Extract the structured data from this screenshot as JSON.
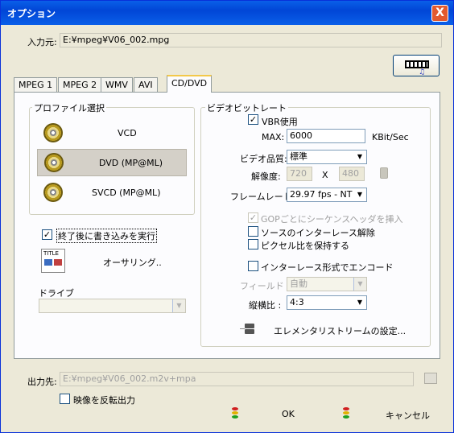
{
  "window": {
    "title": "オプション",
    "close": "X"
  },
  "input": {
    "label": "入力元:",
    "value": "E:¥mpeg¥V06_002.mpg"
  },
  "tabs": [
    "MPEG 1",
    "MPEG 2",
    "WMV",
    "AVI",
    "CD/DVD"
  ],
  "profile": {
    "group_label": "プロファイル選択",
    "items": [
      "VCD",
      "DVD (MP@ML)",
      "SVCD (MP@ML)"
    ]
  },
  "burn": {
    "label": "終了後に書き込みを実行",
    "checked": true
  },
  "authoring": {
    "label": "オーサリング..",
    "icon_text": "TITLE"
  },
  "drive": {
    "label": "ドライブ",
    "value": ""
  },
  "bitrate": {
    "group_label": "ビデオビットレート",
    "vbr_label": "VBR使用",
    "max_label": "MAX:",
    "max_value": "6000",
    "unit": "KBit/Sec"
  },
  "quality": {
    "label": "ビデオ品質:",
    "value": "標準"
  },
  "resolution": {
    "label": "解像度:",
    "w": "720",
    "x": "X",
    "h": "480"
  },
  "framerate": {
    "label": "フレームレート:",
    "value": "29.97 fps - NT"
  },
  "options": {
    "gop": "GOPごとにシーケンスヘッダを挿入",
    "deinterlace": "ソースのインターレース解除",
    "pixel": "ピクセル比を保持する",
    "interlace": "インターレース形式でエンコード"
  },
  "field": {
    "label": "フィールド :",
    "value": "自動"
  },
  "aspect": {
    "label": "縦横比 :",
    "value": "4:3"
  },
  "elementary": {
    "label": "エレメンタリストリームの設定..."
  },
  "output": {
    "label": "出力先:",
    "value": "E:¥mpeg¥V06_002.m2v+mpa"
  },
  "mirror": {
    "label": "映像を反転出力"
  },
  "buttons": {
    "ok": "OK",
    "cancel": "キャンセル"
  }
}
